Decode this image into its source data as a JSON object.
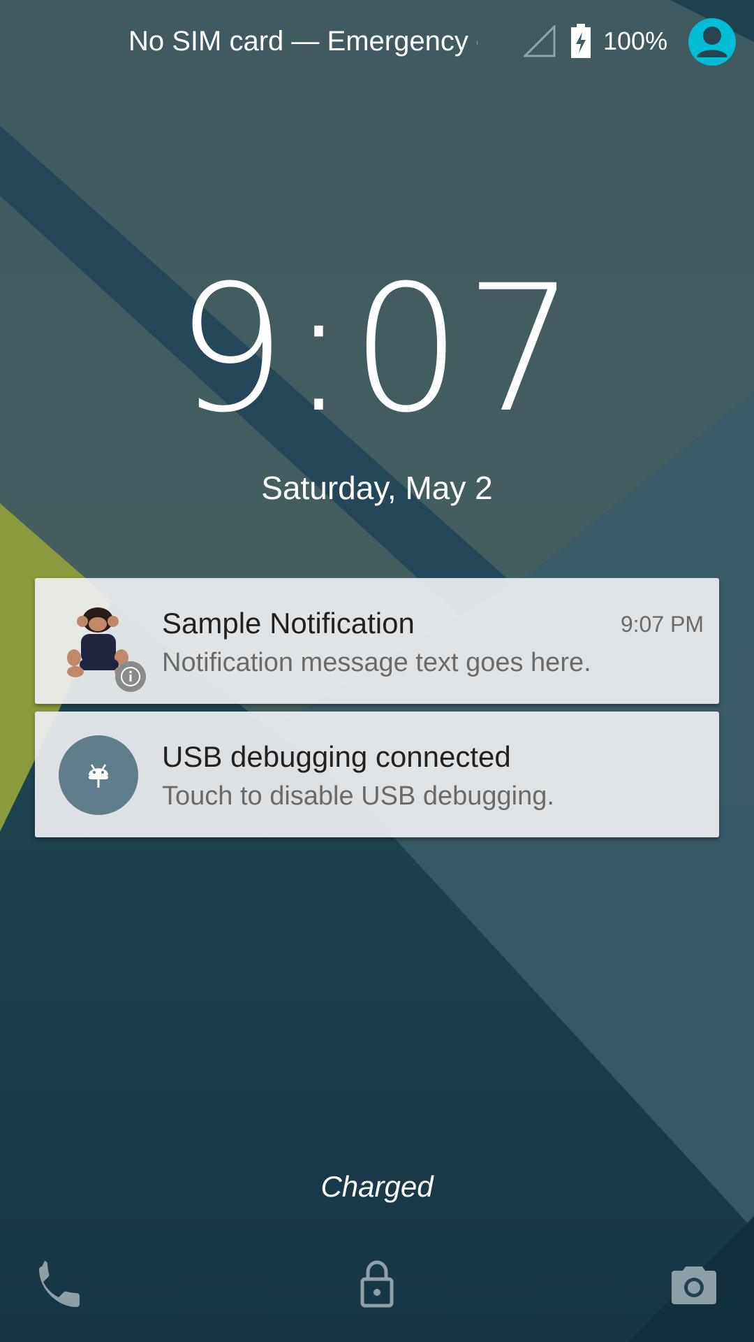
{
  "status_bar": {
    "carrier_text": "No SIM card — Emergency calls only",
    "battery_level": "100%",
    "battery_icon": "battery-charging-icon",
    "signal_icon": "signal-no-sim-icon",
    "user_icon": "user-avatar-icon",
    "avatar_color": "#00bcd4"
  },
  "lockscreen": {
    "time": "9:07",
    "date": "Saturday, May 2",
    "charge_status": "Charged"
  },
  "notifications": [
    {
      "title": "Sample Notification",
      "text": "Notification message text goes here.",
      "time": "9:07 PM",
      "icon": "monkey-photo",
      "badge_icon": "info-icon"
    },
    {
      "title": "USB debugging connected",
      "text": "Touch to disable USB debugging.",
      "icon": "android-debug-icon",
      "icon_background": "#607d8b"
    }
  ],
  "bottom_shortcuts": {
    "left_icon": "phone-icon",
    "center_icon": "lock-icon",
    "right_icon": "camera-icon"
  }
}
